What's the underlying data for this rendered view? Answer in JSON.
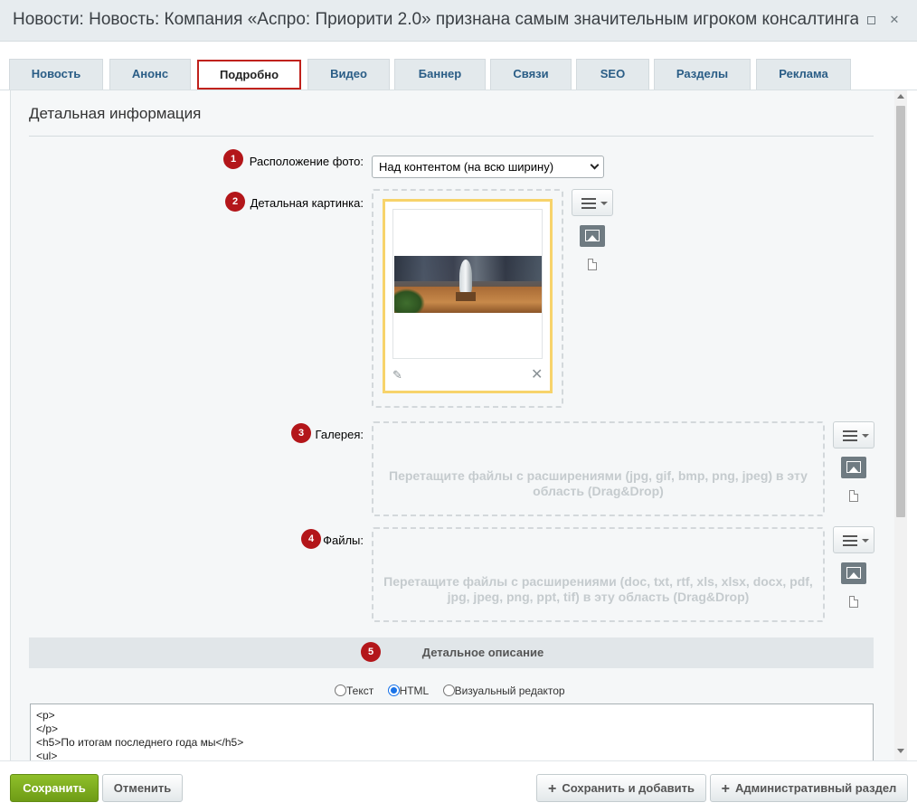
{
  "window": {
    "title": "Новости: Новость: Компания «Аспро: Приорити 2.0» признана самым значительным игроком консалтинга",
    "maximize_icon": "maximize-icon",
    "close_icon": "close-icon",
    "close_glyph": "✕"
  },
  "tabs": [
    {
      "label": "Новость",
      "active": false
    },
    {
      "label": "Анонс",
      "active": false
    },
    {
      "label": "Подробно",
      "active": true
    },
    {
      "label": "Видео",
      "active": false
    },
    {
      "label": "Баннер",
      "active": false
    },
    {
      "label": "Связи",
      "active": false
    },
    {
      "label": "SEO",
      "active": false
    },
    {
      "label": "Разделы",
      "active": false
    },
    {
      "label": "Реклама",
      "active": false
    }
  ],
  "section": {
    "title": "Детальная информация"
  },
  "fields": {
    "photo_position": {
      "badge": "1",
      "label": "Расположение фото:",
      "value": "Над контентом (на всю ширину)"
    },
    "detail_picture": {
      "badge": "2",
      "label": "Детальная картинка:",
      "edit_icon": "pencil-icon",
      "delete_icon": "close-icon",
      "edit_glyph": "✎",
      "delete_glyph": "✕"
    },
    "gallery": {
      "badge": "3",
      "label": "Галерея:",
      "dropzone_text": "Перетащите файлы с расширениями (jpg, gif, bmp, png, jpeg) в эту область (Drag&Drop)"
    },
    "files": {
      "badge": "4",
      "label": "Файлы:",
      "dropzone_text": "Перетащите файлы с расширениями (doc, txt, rtf, xls, xlsx, docx, pdf, jpg, jpeg, png, ppt, tif) в эту область (Drag&Drop)"
    }
  },
  "description": {
    "badge": "5",
    "title": "Детальное описание",
    "modes": [
      {
        "label": "Текст",
        "selected": false
      },
      {
        "label": "HTML",
        "selected": true
      },
      {
        "label": "Визуальный редактор",
        "selected": false
      }
    ],
    "editor_lines": [
      "<p>",
      "</p>",
      "<h5>По итогам последнего года мы</h5>",
      "<ul>"
    ]
  },
  "footer": {
    "save": "Сохранить",
    "cancel": "Отменить",
    "save_and_add": "Сохранить и добавить",
    "admin_section": "Административный раздел",
    "plus_glyph": "+"
  },
  "colors": {
    "accent_badge": "#b3161a",
    "active_tab_border": "#c0211c",
    "save_button": "#7aab1e",
    "thumb_border": "#f7d36b",
    "tab_text": "#2a5d86"
  }
}
